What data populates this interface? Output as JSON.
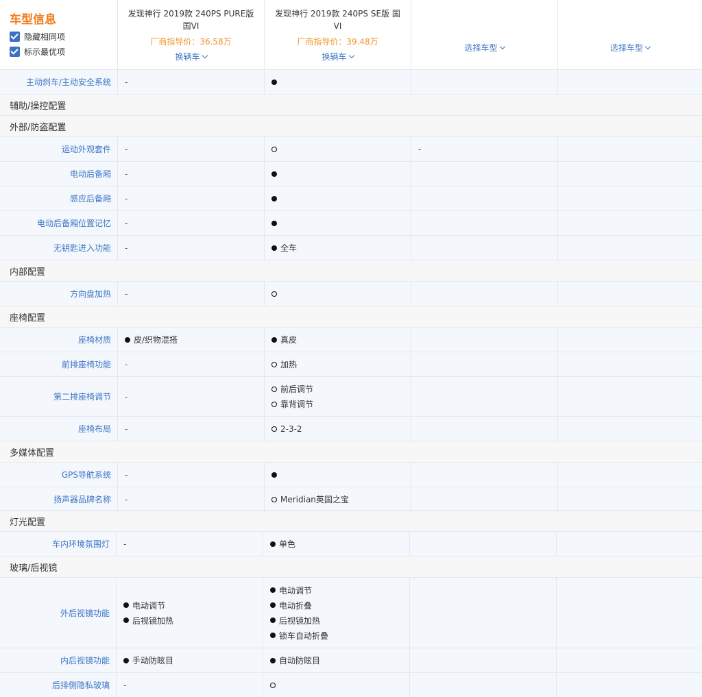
{
  "header": {
    "title": "车型信息",
    "hide_same_label": "隐藏相同项",
    "mark_best_label": "标示最优项",
    "cars": [
      {
        "name": "发现神行 2019款 240PS PURE版 国VI",
        "price": "厂商指导价：36.58万",
        "change_label": "换辆车"
      },
      {
        "name": "发现神行 2019款 240PS SE版 国VI",
        "price": "厂商指导价：39.48万",
        "change_label": "换辆车"
      }
    ],
    "select_label": "选择车型"
  },
  "sections_top": {
    "row_active_safety": {
      "label": "主动刹车/主动安全系统",
      "c1": "-",
      "c2": ""
    },
    "sec_assist": "辅助/操控配置",
    "sec_exterior": "外部/防盗配置",
    "row_sport_kit": {
      "label": "运动外观套件",
      "c1": "-",
      "c2": ""
    },
    "row_power_trunk": {
      "label": "电动后备厢",
      "c1": "-",
      "c2": ""
    },
    "row_sensor_trunk": {
      "label": "感应后备厢",
      "c1": "-",
      "c2": ""
    },
    "row_trunk_memory": {
      "label": "电动后备厢位置记忆",
      "c1": "-",
      "c2": ""
    },
    "row_keyless": {
      "label": "无钥匙进入功能",
      "c1": "-",
      "c2": "全车"
    },
    "sec_interior": "内部配置",
    "row_wheel_heat": {
      "label": "方向盘加热",
      "c1": "-",
      "c2": ""
    },
    "sec_seats": "座椅配置",
    "row_seat_material": {
      "label": "座椅材质",
      "c1": "皮/织物混搭",
      "c2": "真皮"
    },
    "row_front_seat": {
      "label": "前排座椅功能",
      "c1": "-",
      "c2": "加热"
    },
    "row_second_row": {
      "label": "第二排座椅调节",
      "c1": "-",
      "c2a": "前后调节",
      "c2b": "靠背调节"
    },
    "row_seat_layout": {
      "label": "座椅布局",
      "c1": "-",
      "c2": "2-3-2"
    },
    "sec_media": "多媒体配置",
    "row_gps": {
      "label": "GPS导航系统",
      "c1": "-",
      "c2": ""
    },
    "row_speaker": {
      "label": "扬声器品牌名称",
      "c1": "-",
      "c2": "Meridian英国之宝"
    }
  },
  "sections_bottom": {
    "sec_lights": "灯光配置",
    "row_ambient": {
      "label": "车内环境氛围灯",
      "c1": "-",
      "c2": "单色"
    },
    "sec_glass": "玻璃/后视镜",
    "row_ext_mirror": {
      "label": "外后视镜功能",
      "c1a": "电动调节",
      "c1b": "后视镜加热",
      "c2a": "电动调节",
      "c2b": "电动折叠",
      "c2c": "后视镜加热",
      "c2d": "锁车自动折叠"
    },
    "row_int_mirror": {
      "label": "内后视镜功能",
      "c1": "手动防眩目",
      "c2": "自动防眩目"
    },
    "row_privacy_glass": {
      "label": "后排侧隐私玻璃",
      "c1": "-",
      "c2": ""
    }
  },
  "colors": {
    "accent_orange": "#f07c1c",
    "price_orange": "#f0952b",
    "link_blue": "#3d76c5",
    "checkbox_blue": "#3a71c4"
  },
  "icons": {
    "filled": "standard-dot-icon",
    "hollow": "optional-circle-icon"
  }
}
